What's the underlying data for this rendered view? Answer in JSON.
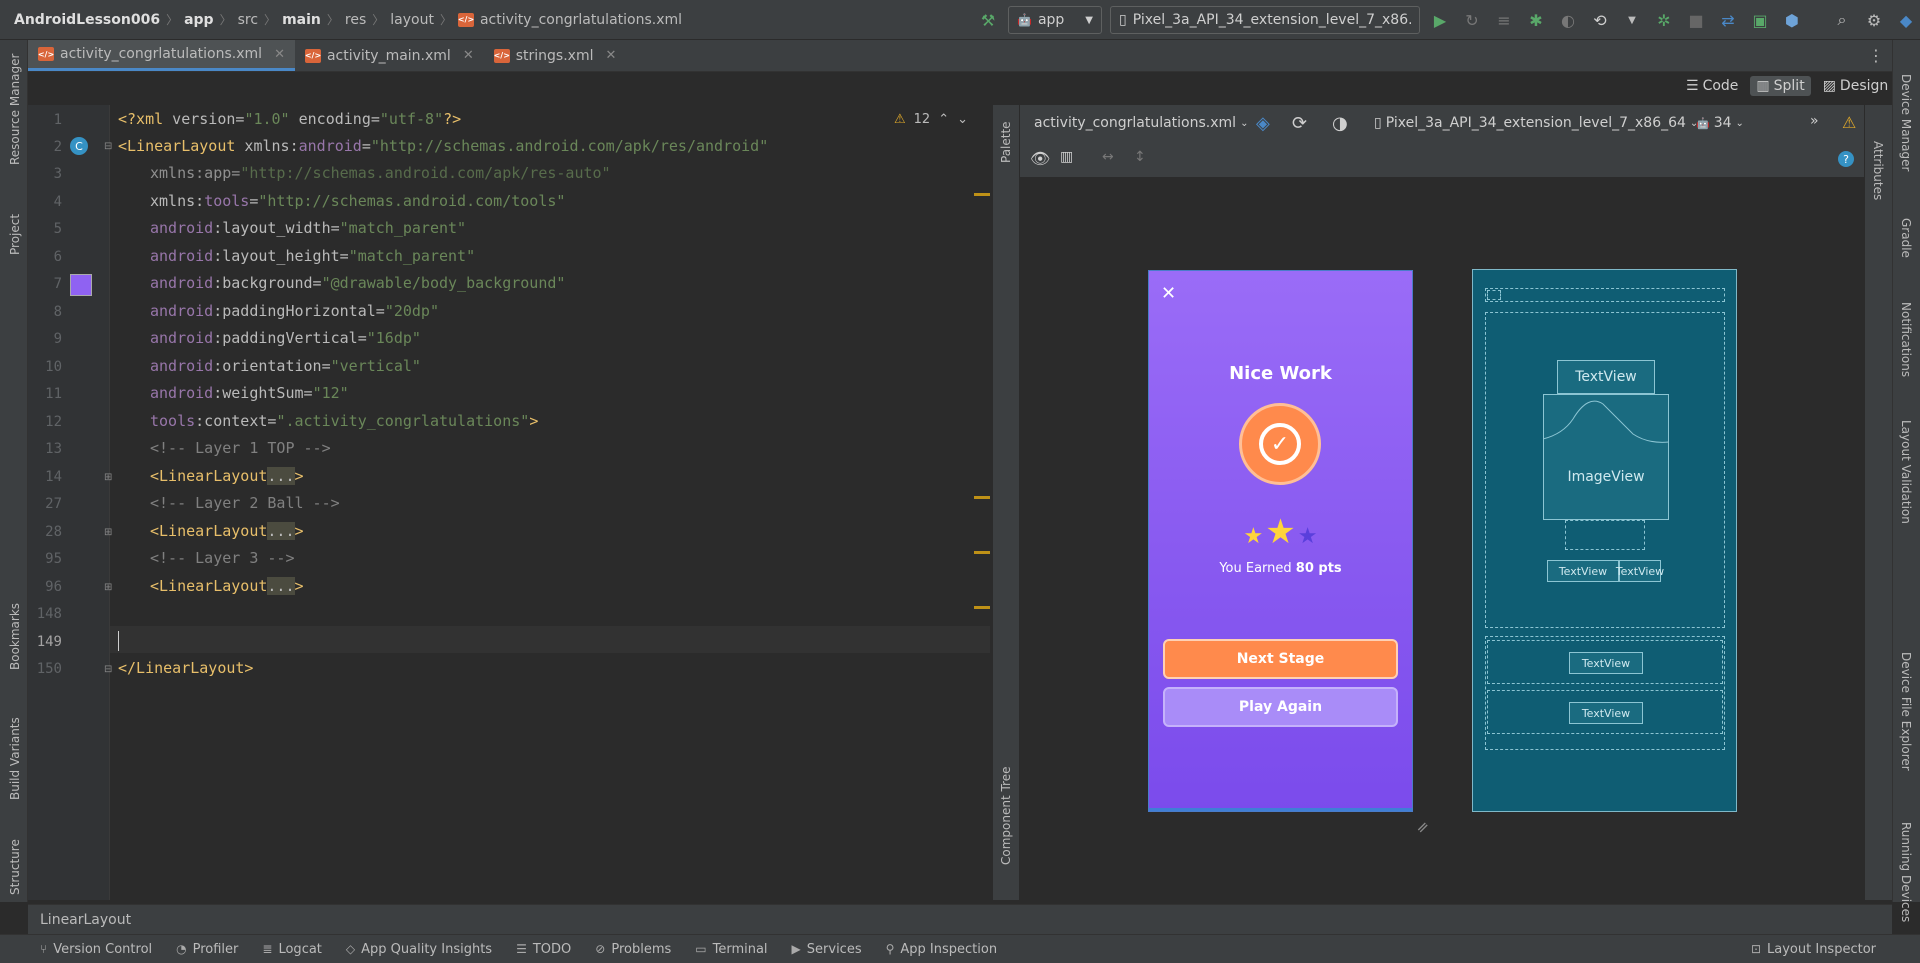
{
  "breadcrumbs": [
    "AndroidLesson006",
    "app",
    "src",
    "main",
    "res",
    "layout",
    "activity_congrlatulations.xml"
  ],
  "toolbar": {
    "config": "app",
    "device": "Pixel_3a_API_34_extension_level_7_x86..."
  },
  "tabs": [
    {
      "label": "activity_congrlatulations.xml",
      "active": true
    },
    {
      "label": "activity_main.xml",
      "active": false
    },
    {
      "label": "strings.xml",
      "active": false
    }
  ],
  "view_modes": {
    "code": "Code",
    "split": "Split",
    "design": "Design"
  },
  "inspection": {
    "warnings": "12"
  },
  "line_numbers": [
    "1",
    "2",
    "3",
    "4",
    "5",
    "6",
    "7",
    "8",
    "9",
    "10",
    "11",
    "12",
    "13",
    "14",
    "27",
    "28",
    "95",
    "96",
    "148",
    "149",
    "150"
  ],
  "code": {
    "l1": {
      "open": "<?xml",
      "a1": " version=",
      "v1": "\"1.0\"",
      "a2": " encoding=",
      "v2": "\"utf-8\"",
      "close": "?>"
    },
    "l2": {
      "tag": "<LinearLayout",
      "ns1": " xmlns:",
      "ns2": "android",
      "eq": "=",
      "val": "\"http://schemas.android.com/apk/res/android\""
    },
    "l3": {
      "attr": "xmlns:app=",
      "val": "\"http://schemas.android.com/apk/res-auto\""
    },
    "l4": {
      "ns1": "xmlns:",
      "ns2": "tools",
      "eq": "=",
      "val": "\"http://schemas.android.com/tools\""
    },
    "l5": {
      "ns": "android",
      "attr": ":layout_width=",
      "val": "\"match_parent\""
    },
    "l6": {
      "ns": "android",
      "attr": ":layout_height=",
      "val": "\"match_parent\""
    },
    "l7": {
      "ns": "android",
      "attr": ":background=",
      "val": "\"@drawable/body_background\""
    },
    "l8": {
      "ns": "android",
      "attr": ":paddingHorizontal=",
      "val": "\"20dp\""
    },
    "l9": {
      "ns": "android",
      "attr": ":paddingVertical=",
      "val": "\"16dp\""
    },
    "l10": {
      "ns": "android",
      "attr": ":orientation=",
      "val": "\"vertical\""
    },
    "l11": {
      "ns": "android",
      "attr": ":weightSum=",
      "val": "\"12\""
    },
    "l12": {
      "ns": "tools",
      "attr": ":context=",
      "val": "\".activity_congrlatulations\"",
      "close": ">"
    },
    "l13": "<!-- Layer 1 TOP -->",
    "l14": {
      "tag": "<LinearLayout",
      "fold": "...",
      "close": ">"
    },
    "l27": "<!-- Layer 2 Ball -->",
    "l28": {
      "tag": "<LinearLayout",
      "fold": "...",
      "close": ">"
    },
    "l95": "<!-- Layer 3 -->",
    "l96": {
      "tag": "<LinearLayout",
      "fold": "...",
      "close": ">"
    },
    "l150": "</LinearLayout>"
  },
  "design": {
    "file": "activity_congrlatulations.xml",
    "device": "Pixel_3a_API_34_extension_level_7_x86_64",
    "api": "34",
    "palette": "Palette",
    "component_tree": "Component Tree",
    "attributes": "Attributes"
  },
  "preview": {
    "close": "✕",
    "title": "Nice Work",
    "earned_prefix": "You Earned ",
    "earned_points": "80 pts",
    "next_button": "Next Stage",
    "play_button": "Play Again",
    "stars_filled": 2,
    "stars_total": 3
  },
  "blueprint": {
    "textview": "TextView",
    "imageview": "ImageView",
    "small_textview_1": "TextView",
    "small_textview_2": "TextView",
    "btn_textview_1": "TextView",
    "btn_textview_2": "TextView"
  },
  "status": {
    "breadcrumb": "LinearLayout"
  },
  "left_tools": [
    "Resource Manager",
    "Project",
    "Bookmarks",
    "Build Variants",
    "Structure"
  ],
  "right_tools": [
    "Device Manager",
    "Gradle",
    "Notifications",
    "Layout Validation",
    "Device File Explorer",
    "Running Devices"
  ],
  "bottom_tools": [
    "Version Control",
    "Profiler",
    "Logcat",
    "App Quality Insights",
    "TODO",
    "Problems",
    "Terminal",
    "Services",
    "App Inspection"
  ],
  "layout_inspector": "Layout Inspector",
  "colors": {
    "accent": "#4a88c7",
    "phone_top": "#9a6cf7",
    "button_orange": "#ff8a4c",
    "button_purple": "#a98cf8",
    "blueprint": "#0f5d73"
  }
}
